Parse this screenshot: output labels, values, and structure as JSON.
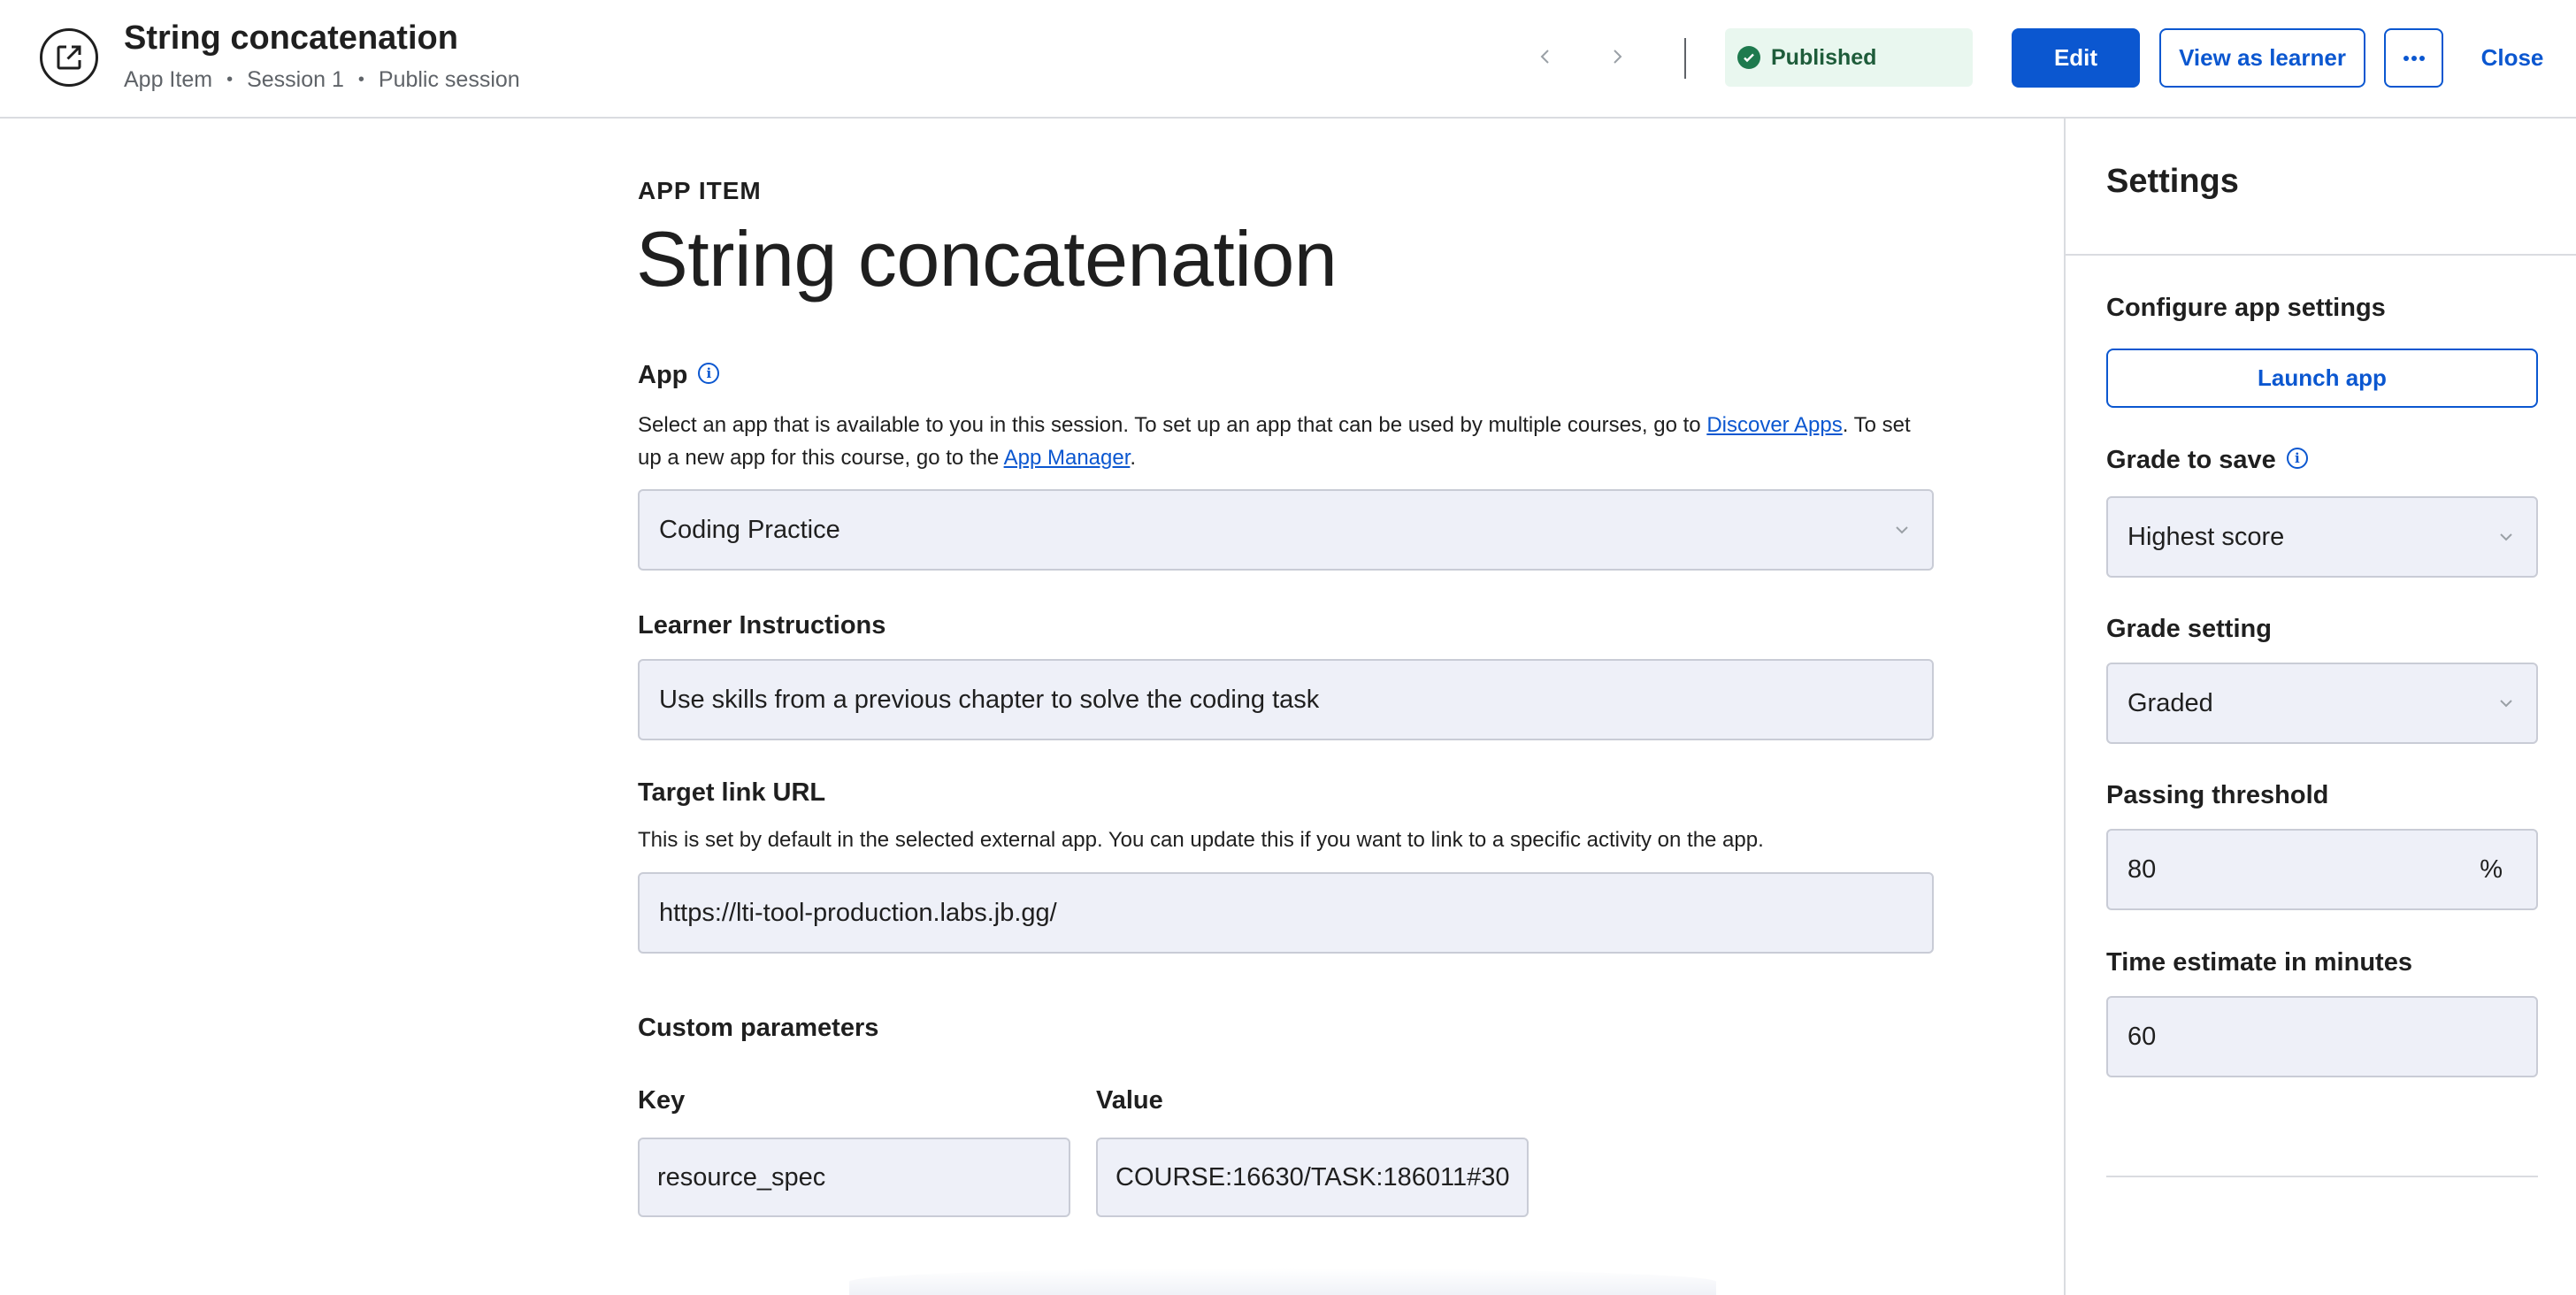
{
  "header": {
    "title": "String concatenation",
    "breadcrumb": [
      "App Item",
      "Session 1",
      "Public session"
    ],
    "status": "Published",
    "edit_label": "Edit",
    "view_as_learner_label": "View as learner",
    "close_label": "Close"
  },
  "main": {
    "eyebrow": "APP ITEM",
    "title": "String concatenation",
    "app": {
      "label": "App",
      "help_before": "Select an app that is available to you in this session. To set up an app that can be used by multiple courses, go to ",
      "link1": "Discover Apps",
      "help_middle": ". To set up a new app for this course, go to the ",
      "link2": "App Manager",
      "help_after": ".",
      "selected": "Coding Practice"
    },
    "instructions": {
      "label": "Learner Instructions",
      "value": "Use skills from a previous chapter to solve the coding task"
    },
    "target_url": {
      "label": "Target link URL",
      "help": "This is set by default in the selected external app. You can update this if you want to link to a specific activity on the app.",
      "value": "https://lti-tool-production.labs.jb.gg/"
    },
    "custom_params": {
      "label": "Custom parameters",
      "key_label": "Key",
      "value_label": "Value",
      "key": "resource_spec",
      "value": "COURSE:16630/TASK:186011#30"
    }
  },
  "settings": {
    "title": "Settings",
    "configure_label": "Configure app settings",
    "launch_label": "Launch app",
    "grade_to_save_label": "Grade to save",
    "grade_to_save_value": "Highest score",
    "grade_setting_label": "Grade setting",
    "grade_setting_value": "Graded",
    "passing_threshold_label": "Passing threshold",
    "passing_threshold_value": "80",
    "passing_threshold_unit": "%",
    "time_estimate_label": "Time estimate in minutes",
    "time_estimate_value": "60"
  },
  "colors": {
    "accent": "#0b57d0",
    "published_bg": "#e9f7ef",
    "published_icon": "#1e7a4e",
    "field_bg": "#eef0f8"
  }
}
